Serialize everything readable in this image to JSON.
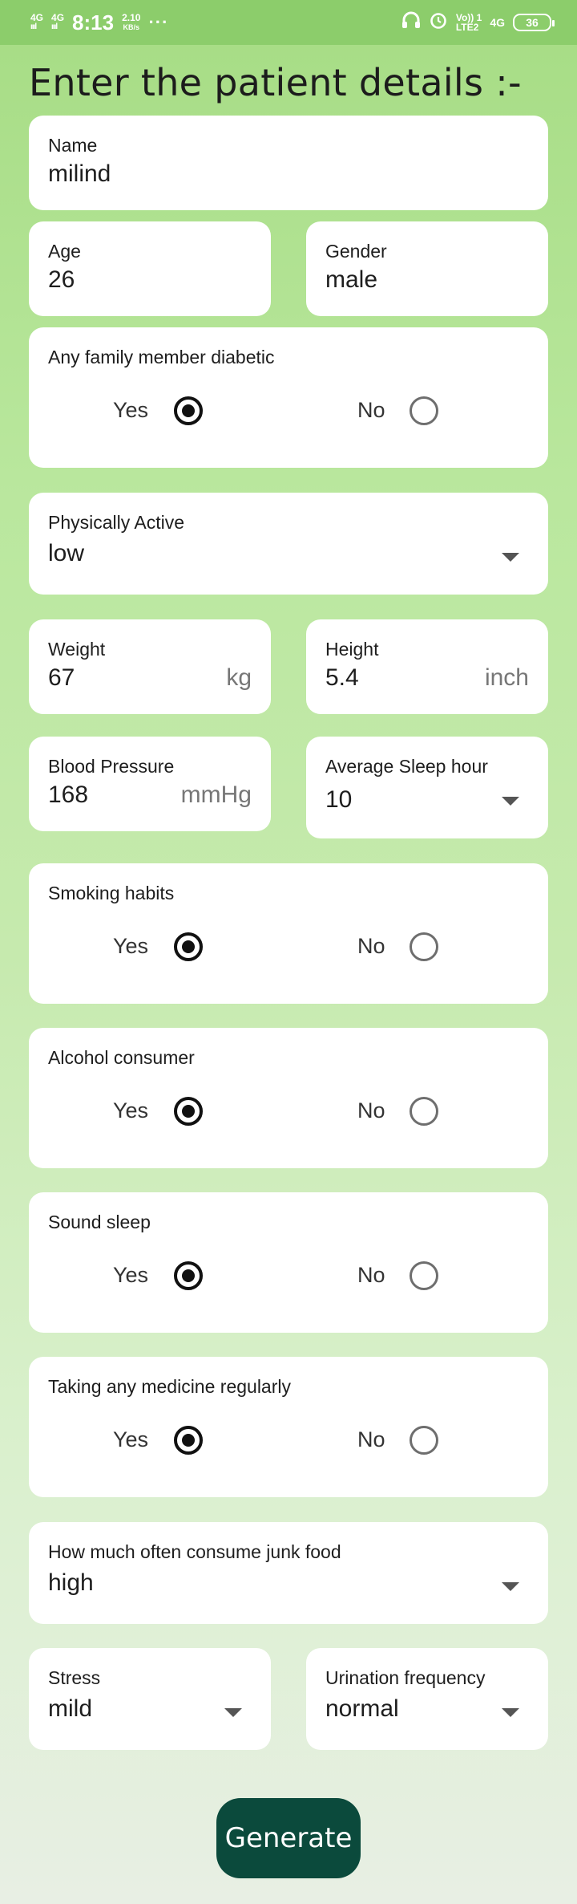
{
  "status_bar": {
    "net1": "4G",
    "net2": "4G",
    "time": "8:13",
    "speed_value": "2.10",
    "speed_unit": "KB/s",
    "dots": "···",
    "volte": "Vo)) 1",
    "lte": "LTE2",
    "net3": "4G",
    "battery": "36"
  },
  "title": "Enter the patient details :-",
  "fields": {
    "name": {
      "label": "Name",
      "value": "milind"
    },
    "age": {
      "label": "Age",
      "value": "26"
    },
    "gender": {
      "label": "Gender",
      "value": "male"
    },
    "physically_active": {
      "label": "Physically Active",
      "value": "low"
    },
    "weight": {
      "label": "Weight",
      "value": "67",
      "unit": "kg"
    },
    "height": {
      "label": "Height",
      "value": "5.4",
      "unit": "inch"
    },
    "blood_pressure": {
      "label": "Blood Pressure",
      "value": "168",
      "unit": "mmHg"
    },
    "sleep_hour": {
      "label": "Average Sleep hour",
      "value": "10"
    },
    "junk_food": {
      "label": "How much often consume junk food",
      "value": "high"
    },
    "stress": {
      "label": "Stress",
      "value": "mild"
    },
    "urination": {
      "label": "Urination frequency",
      "value": "normal"
    }
  },
  "radio_groups": {
    "family_diabetic": {
      "label": "Any family member diabetic",
      "yes": "Yes",
      "no": "No",
      "selected": "Yes"
    },
    "smoking": {
      "label": "Smoking habits",
      "yes": "Yes",
      "no": "No",
      "selected": "Yes"
    },
    "alcohol": {
      "label": "Alcohol consumer",
      "yes": "Yes",
      "no": "No",
      "selected": "Yes"
    },
    "sound_sleep": {
      "label": "Sound sleep",
      "yes": "Yes",
      "no": "No",
      "selected": "Yes"
    },
    "medicine": {
      "label": "Taking any medicine regularly",
      "yes": "Yes",
      "no": "No",
      "selected": "Yes"
    }
  },
  "generate_label": "Generate",
  "icons": [
    "headphones-icon",
    "alarm-icon",
    "battery-icon",
    "dropdown-caret-icon",
    "radio-icon"
  ],
  "colors": {
    "accent": "#0b4a3c",
    "statusbar": "#8ccd6b"
  }
}
